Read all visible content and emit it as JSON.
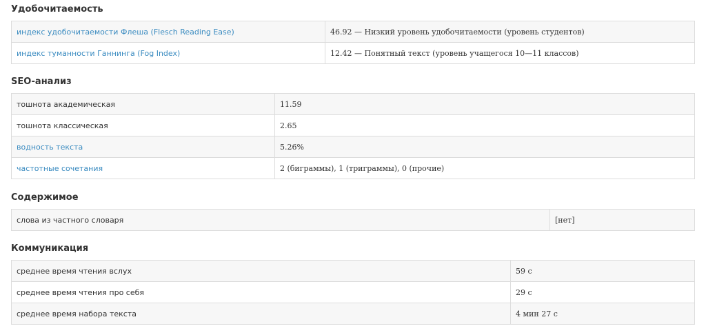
{
  "readability": {
    "title": "Удобочитаемость",
    "rows": [
      {
        "label": "индекс удобочитаемости Флеша (Flesch Reading Ease)",
        "value": "46.92 — Низкий уровень удобочитаемости (уровень студентов)"
      },
      {
        "label": "индекс туманности Ганнинга (Fog Index)",
        "value": "12.42 — Понятный текст (уровень учащегося 10—11 классов)"
      }
    ]
  },
  "seo": {
    "title": "SEO-анализ",
    "rows": [
      {
        "label": "тошнота академическая",
        "value": "11.59"
      },
      {
        "label": "тошнота классическая",
        "value": "2.65"
      },
      {
        "label": "водность текста",
        "value": "5.26%"
      },
      {
        "label": "частотные сочетания",
        "value": "2 (биграммы), 1 (триграммы), 0 (прочие)"
      }
    ]
  },
  "content": {
    "title": "Содержимое",
    "rows": [
      {
        "label": "слова из частного словаря",
        "value": "[нет]"
      }
    ]
  },
  "communication": {
    "title": "Коммуникация",
    "rows": [
      {
        "label": "среднее время чтения вслух",
        "value": "59 с"
      },
      {
        "label": "среднее время чтения про себя",
        "value": "29 с"
      },
      {
        "label": "среднее время набора текста",
        "value": "4 мин 27 с"
      }
    ]
  },
  "colors": {
    "link": "#3a8bc0",
    "heading": "#333333",
    "row_alt": "#f7f7f7",
    "border": "#dcdcdc"
  }
}
